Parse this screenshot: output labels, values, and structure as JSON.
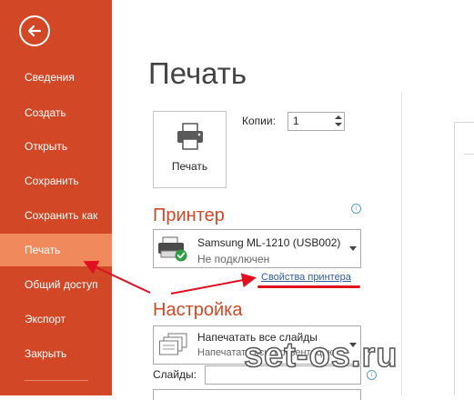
{
  "sidebar": {
    "items": [
      {
        "label": "Сведения",
        "active": false
      },
      {
        "label": "Создать",
        "active": false
      },
      {
        "label": "Открыть",
        "active": false
      },
      {
        "label": "Сохранить",
        "active": false
      },
      {
        "label": "Сохранить как",
        "active": false
      },
      {
        "label": "Печать",
        "active": true
      },
      {
        "label": "Общий доступ",
        "active": false
      },
      {
        "label": "Экспорт",
        "active": false
      },
      {
        "label": "Закрыть",
        "active": false
      }
    ]
  },
  "main": {
    "title": "Печать",
    "print_button_label": "Печать",
    "copies_label": "Копии:",
    "copies_value": "1"
  },
  "printer": {
    "heading": "Принтер",
    "name": "Samsung ML-1210 (USB002)",
    "status": "Не подключен",
    "properties_link": "Свойства принтера"
  },
  "settings": {
    "heading": "Настройка",
    "slides_main": "Напечатать все слайды",
    "slides_sub": "Напечатать всю презентацию",
    "slides_label": "Слайды:",
    "slides_value": ""
  },
  "watermark": "set-os.ru",
  "colors": {
    "accent": "#d24726",
    "sidebar_active": "#f08a5c",
    "annotation_red": "#e01020",
    "link": "#2f5b9a"
  }
}
